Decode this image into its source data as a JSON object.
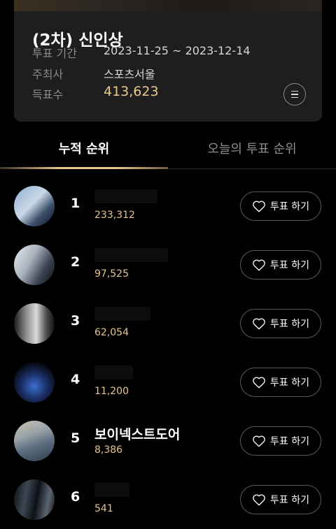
{
  "card": {
    "title": "(2차) 신인상",
    "period_label": "투표 기간",
    "period_value": "2023-11-25 ~ 2023-12-14",
    "host_label": "주최사",
    "host_value": "스포츠서울",
    "votes_label": "득표수",
    "votes_value": "413,623",
    "menu_icon": "list-icon"
  },
  "tabs": {
    "cumulative": "누적 순위",
    "today": "오늘의 투표 순위"
  },
  "colors": {
    "accent_gold": "#e6c48d",
    "background": "#000000",
    "card": "#1e1e20"
  },
  "rankings": [
    {
      "rank": "1",
      "name": "",
      "votes": "233,312",
      "button": "투표 하기"
    },
    {
      "rank": "2",
      "name": "",
      "votes": "97,525",
      "button": "투표 하기"
    },
    {
      "rank": "3",
      "name": "",
      "votes": "62,054",
      "button": "투표 하기"
    },
    {
      "rank": "4",
      "name": "",
      "votes": "11,200",
      "button": "투표 하기"
    },
    {
      "rank": "5",
      "name": "보이넥스트도어",
      "votes": "8,386",
      "button": "투표 하기"
    },
    {
      "rank": "6",
      "name": "",
      "votes": "541",
      "button": "투표 하기"
    }
  ]
}
